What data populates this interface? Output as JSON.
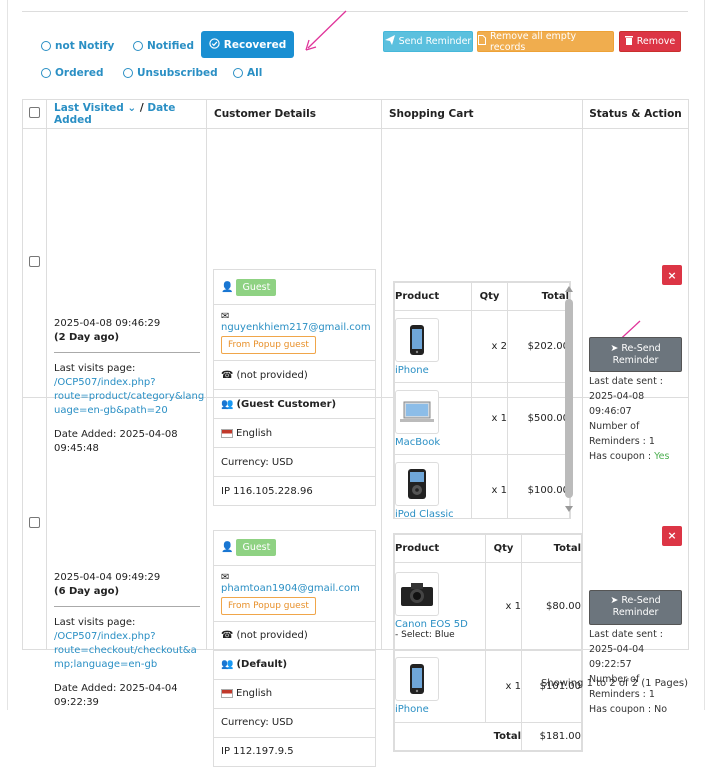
{
  "filters": {
    "not_notify": "not Notify",
    "notified": "Notified",
    "recovered": "Recovered",
    "ordered": "Ordered",
    "unsubscribed": "Unsubscribed",
    "all": "All"
  },
  "actions": {
    "send_reminder": "Send Reminder",
    "remove_empty": "Remove all empty records",
    "remove": "Remove"
  },
  "colors": {
    "accent": "#1a8fd2",
    "info": "#5bc0de",
    "warning": "#f0ad4e",
    "danger": "#dc3545",
    "arrow": "#e0349a"
  },
  "table": {
    "headers": {
      "last_visited": "Last Visited",
      "slash": "/",
      "date_added": "Date Added",
      "customer": "Customer Details",
      "cart": "Shopping Cart",
      "status": "Status & Action"
    },
    "rows": [
      {
        "visited": "2025-04-08 09:46:29",
        "ago": "(2 Day ago)",
        "last_page_label": "Last visits page:",
        "last_page_url_1": "/OCP507/index.php?",
        "last_page_url_2": "route=product/category&lang",
        "last_page_url_3": "uage=en-gb&path=20",
        "added_1": "Date Added: 2025-04-08",
        "added_2": "09:45:48",
        "guest": "Guest",
        "email": "nguyenkhiem217@gmail.com",
        "popup": "From Popup guest",
        "phone": "(not provided)",
        "group": "(Guest Customer)",
        "language": "English",
        "currency": "Currency: USD",
        "ip": "IP 116.105.228.96",
        "cart": {
          "h_product": "Product",
          "h_qty": "Qty",
          "h_total": "Total",
          "items": [
            {
              "name": "iPhone",
              "qty": "x 2",
              "total": "$202.00",
              "icon": "iphone-icon"
            },
            {
              "name": "MacBook",
              "qty": "x 1",
              "total": "$500.00",
              "icon": "laptop-icon"
            },
            {
              "name": "iPod Classic",
              "qty": "x 1",
              "total": "$100.00",
              "icon": "ipod-icon"
            }
          ]
        },
        "resend_1": "Re-Send",
        "resend_2": "Reminder",
        "last_sent_label": "Last date sent :",
        "last_sent_date": "2025-04-08",
        "last_sent_time": "09:46:07",
        "num_label": "Number of",
        "num_value": "Reminders : 1",
        "coupon_label": "Has coupon :",
        "coupon_value": "Yes",
        "close": "×"
      },
      {
        "visited": "2025-04-04 09:49:29",
        "ago": "(6 Day ago)",
        "last_page_label": "Last visits page:",
        "last_page_url_1": "/OCP507/index.php?",
        "last_page_url_2": "route=checkout/checkout&a",
        "last_page_url_3": "mp;language=en-gb",
        "added_1": "Date Added: 2025-04-04",
        "added_2": "09:22:39",
        "guest": "Guest",
        "email": "phamtoan1904@gmail.com",
        "popup": "From Popup guest",
        "phone": "(not provided)",
        "group": "(Default)",
        "language": "English",
        "currency": "Currency: USD",
        "ip": "IP 112.197.9.5",
        "cart": {
          "h_product": "Product",
          "h_qty": "Qty",
          "h_total": "Total",
          "items": [
            {
              "name": "Canon EOS 5D",
              "option": "- Select: Blue",
              "qty": "x 1",
              "total": "$80.00",
              "icon": "camera-icon"
            },
            {
              "name": "iPhone",
              "qty": "x 1",
              "total": "$101.00",
              "icon": "iphone-icon"
            }
          ],
          "total_label": "Total",
          "total_value": "$181.00"
        },
        "resend_1": "Re-Send",
        "resend_2": "Reminder",
        "last_sent_label": "Last date sent :",
        "last_sent_date": "2025-04-04",
        "last_sent_time": "09:22:57",
        "num_label": "Number of",
        "num_value": "Reminders : 1",
        "coupon_label": "Has coupon :",
        "coupon_value": "No",
        "close": "×"
      }
    ]
  },
  "footer": {
    "showing": "Showing 1 to 2 of 2 (1 Pages)"
  }
}
